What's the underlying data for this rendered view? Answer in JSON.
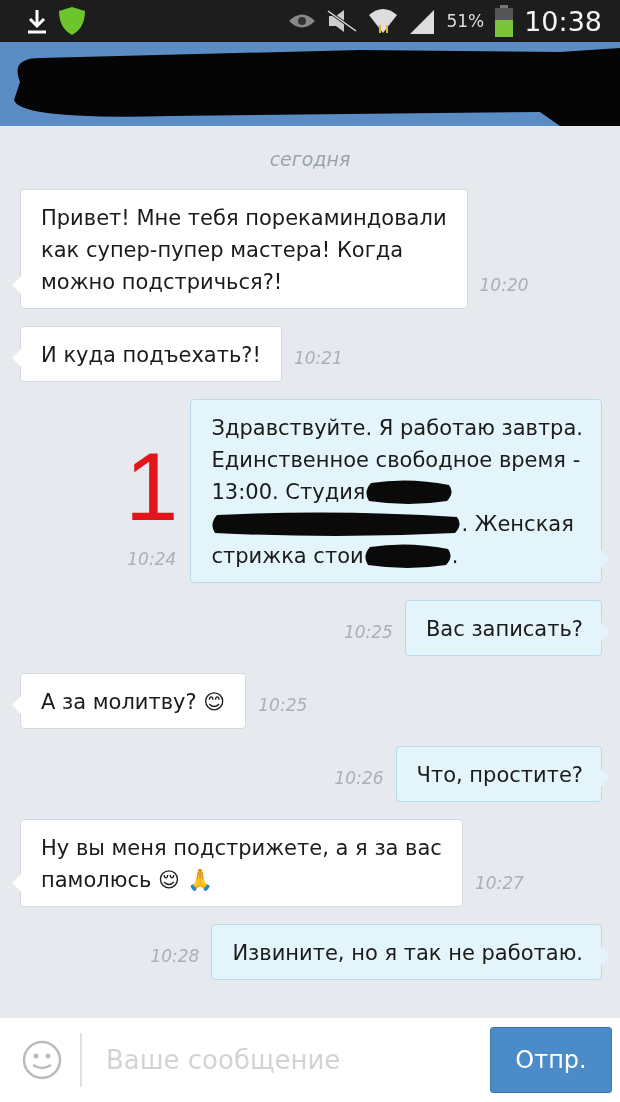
{
  "status_bar": {
    "battery_text": "51%",
    "time": "10:38"
  },
  "date_divider": "сегодня",
  "messages": [
    {
      "kind": "in",
      "lines": [
        [
          {
            "kind": "text",
            "text": "Привет! Мне тебя порекаминдовали"
          }
        ],
        [
          {
            "kind": "text",
            "text": "как супер-пупер мастера! Когда"
          }
        ],
        [
          {
            "kind": "text",
            "text": "можно подстричься?!"
          }
        ]
      ],
      "time": "10:20"
    },
    {
      "kind": "in",
      "lines": [
        [
          {
            "kind": "text",
            "text": "И куда подъехать?!"
          }
        ]
      ],
      "time": "10:21"
    },
    {
      "kind": "out",
      "annotation": "1",
      "lines": [
        [
          {
            "kind": "text",
            "text": "Здравствуйте. Я работаю завтра."
          }
        ],
        [
          {
            "kind": "text",
            "text": "Единственное свободное время -"
          }
        ],
        [
          {
            "kind": "text",
            "text": "13:00. Студия"
          },
          {
            "kind": "redaction"
          }
        ],
        [
          {
            "kind": "redaction"
          },
          {
            "kind": "text",
            "text": ". Женская"
          }
        ],
        [
          {
            "kind": "text",
            "text": "стрижка стои"
          },
          {
            "kind": "redaction"
          },
          {
            "kind": "text",
            "text": "."
          }
        ]
      ],
      "time": "10:24"
    },
    {
      "kind": "out",
      "lines": [
        [
          {
            "kind": "text",
            "text": "Вас записать?"
          }
        ]
      ],
      "time": "10:25"
    },
    {
      "kind": "in",
      "lines": [
        [
          {
            "kind": "text",
            "text": "А за молитву? 😊"
          }
        ]
      ],
      "time": "10:25"
    },
    {
      "kind": "out",
      "lines": [
        [
          {
            "kind": "text",
            "text": "Что, простите?"
          }
        ]
      ],
      "time": "10:26"
    },
    {
      "kind": "in",
      "lines": [
        [
          {
            "kind": "text",
            "text": "Ну вы меня подстрижете, а я за вас"
          }
        ],
        [
          {
            "kind": "text",
            "text": "памолюсь 😌 🙏"
          }
        ]
      ],
      "time": "10:27"
    },
    {
      "kind": "out",
      "lines": [
        [
          {
            "kind": "text",
            "text": "Извините, но я так не работаю."
          }
        ]
      ],
      "time": "10:28"
    }
  ],
  "composer": {
    "placeholder": "Ваше сообщение",
    "send_label": "Отпр."
  }
}
